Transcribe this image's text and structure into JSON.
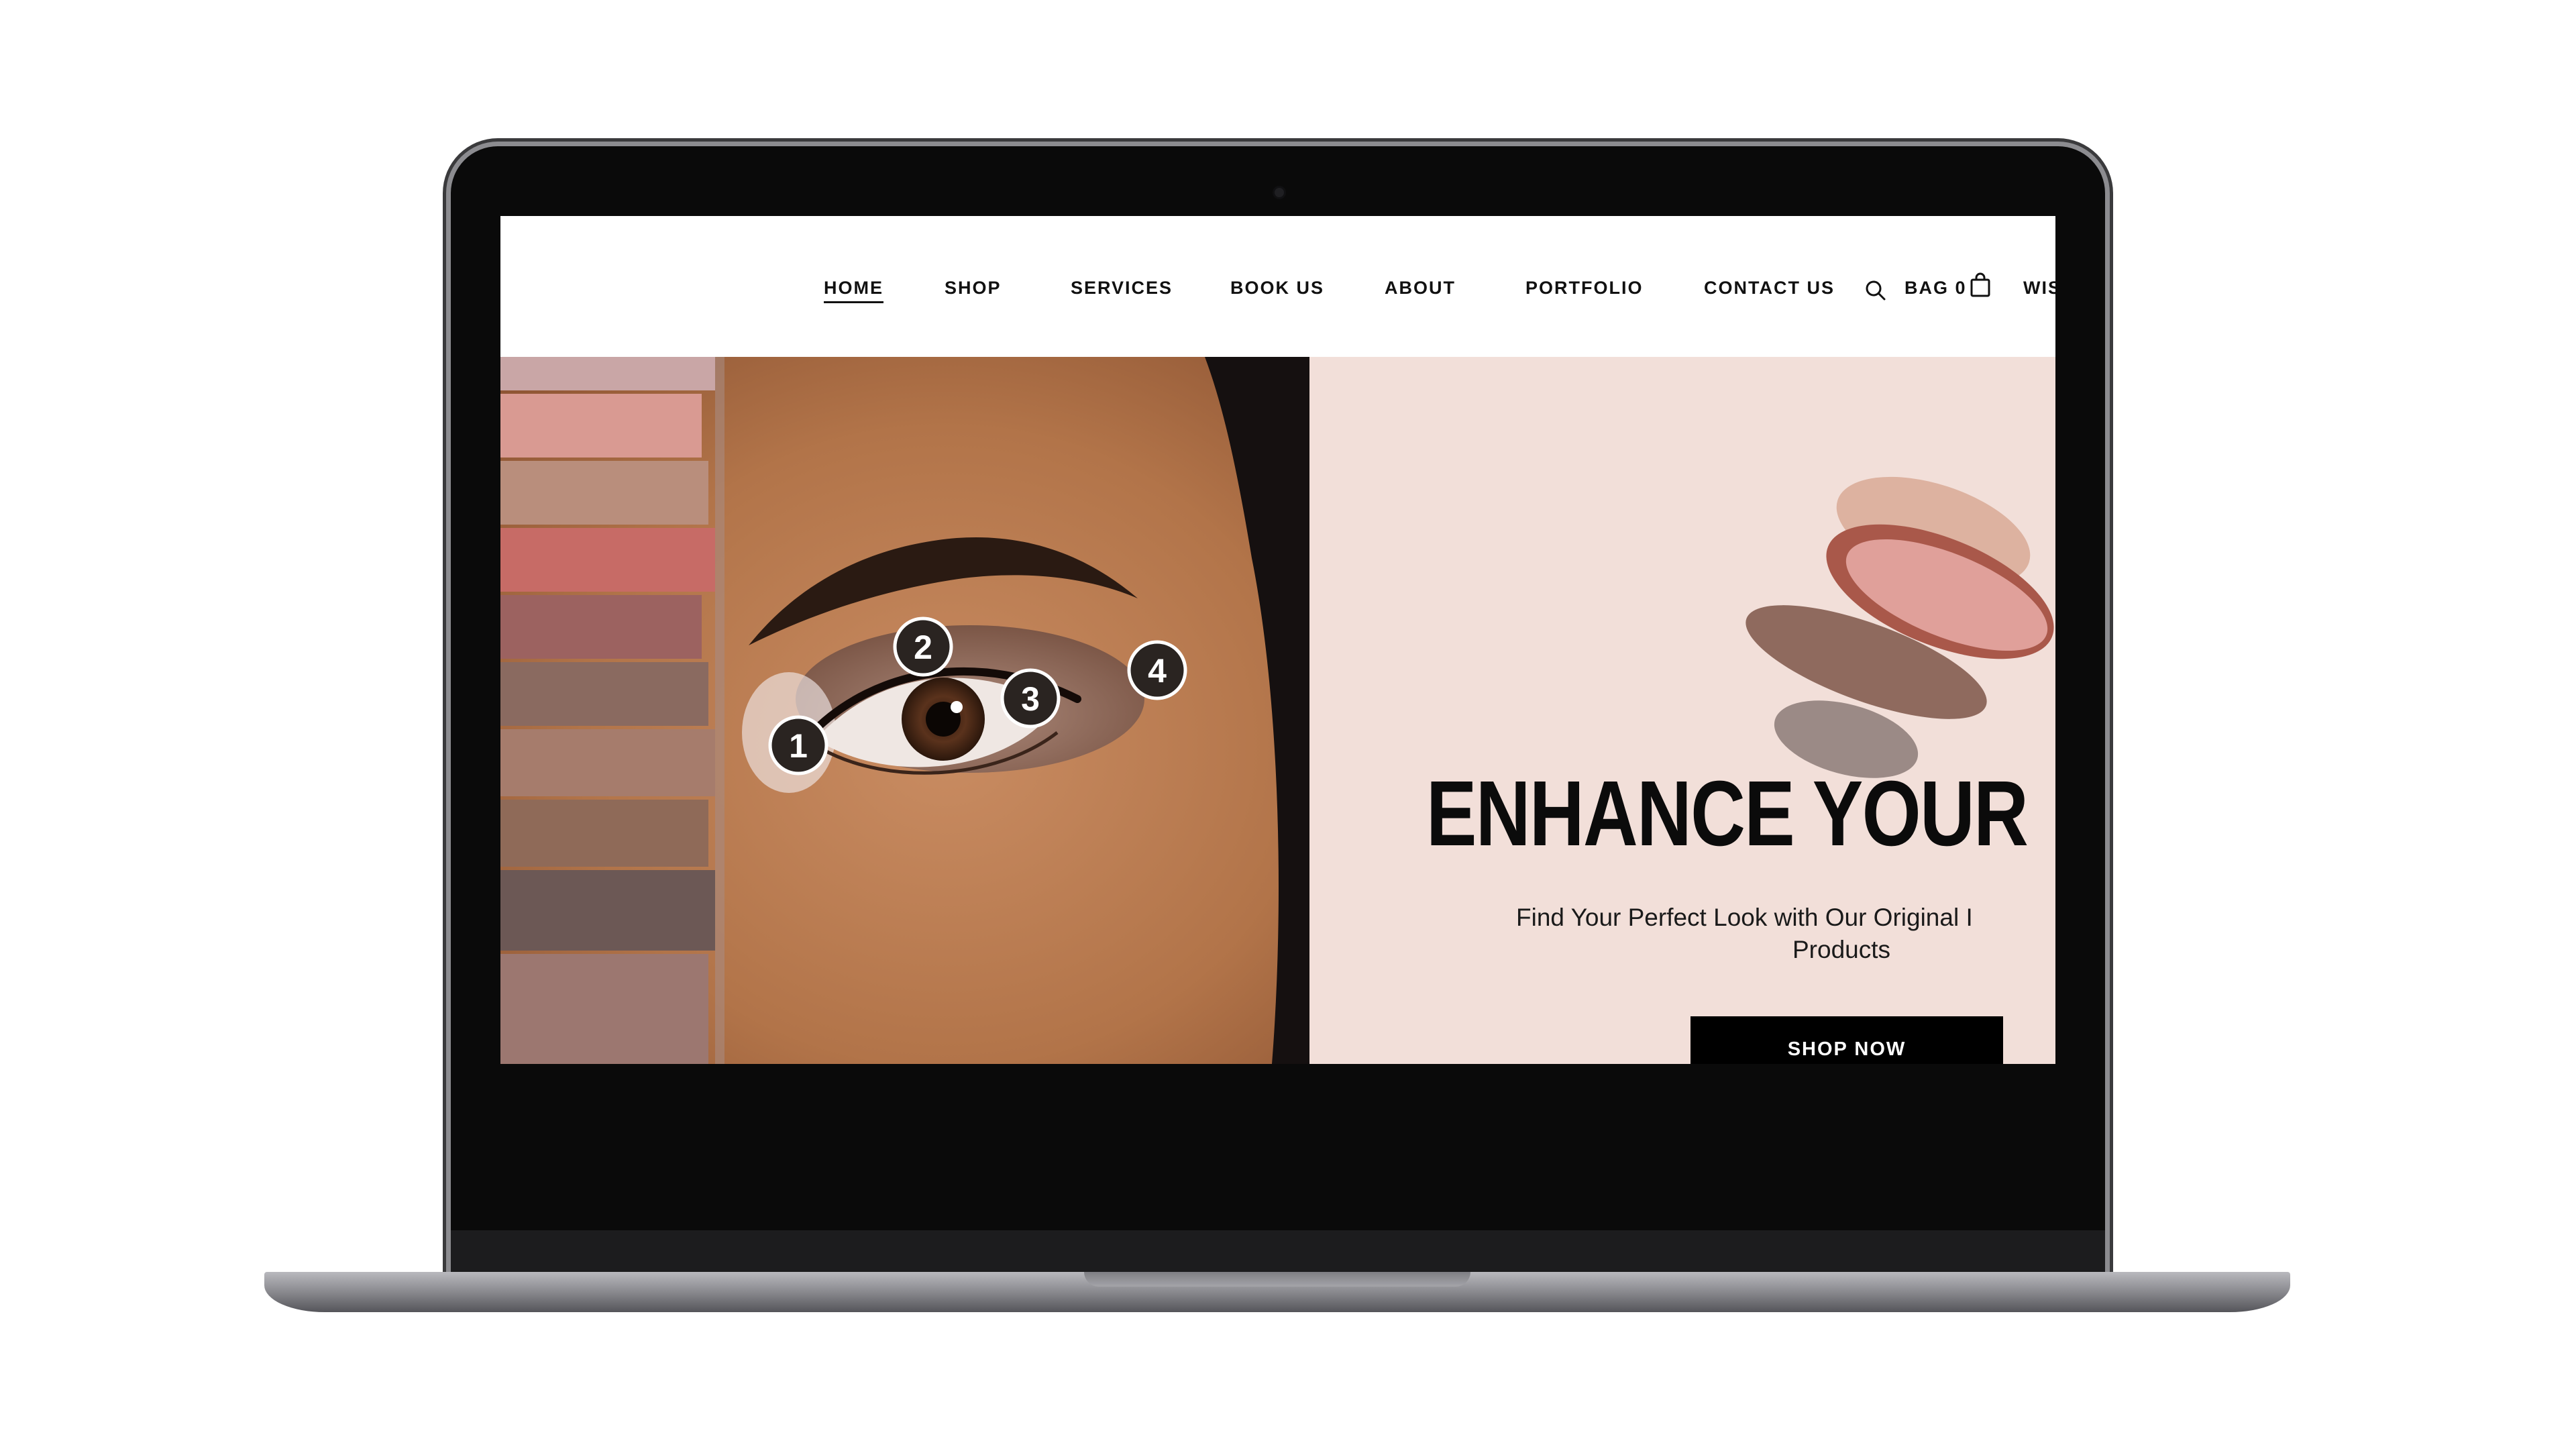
{
  "nav": {
    "items": [
      "HOME",
      "SHOP",
      "SERVICES",
      "BOOK US",
      "ABOUT",
      "PORTFOLIO",
      "CONTACT US"
    ],
    "active_item": "HOME",
    "bag_label": "BAG 0",
    "wish_label": "WIS"
  },
  "icons": {
    "search": "search-icon",
    "bag": "shopping-bag-icon"
  },
  "hero": {
    "title": "ENHANCE YOUR",
    "subtitle_line1": "Find Your Perfect Look with Our Original I",
    "subtitle_line2": "Products",
    "cta_label": "SHOP NOW",
    "markers": [
      "1",
      "2",
      "3",
      "4"
    ]
  },
  "colors": {
    "hero_background": "#f2dfd9",
    "cta_background": "#000000",
    "cta_text": "#ffffff",
    "text": "#111111"
  }
}
